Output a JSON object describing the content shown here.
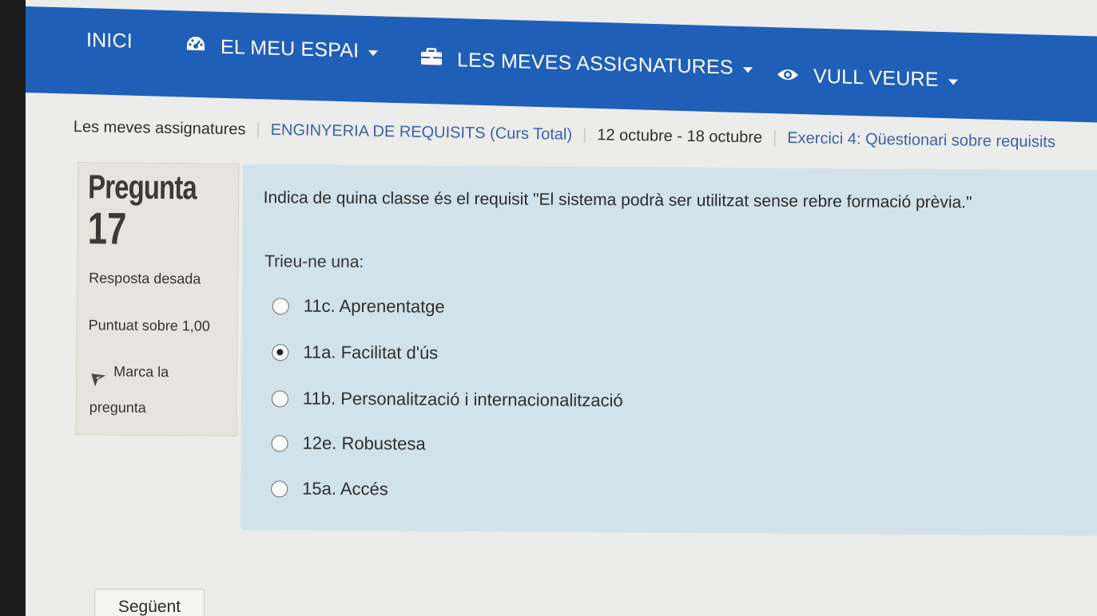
{
  "navbar": {
    "items": [
      {
        "label": "INICI",
        "icon": ""
      },
      {
        "label": "EL MEU ESPAI",
        "icon": "dashboard-icon"
      },
      {
        "label": "LES MEVES ASSIGNATURES",
        "icon": "briefcase-icon"
      },
      {
        "label": "VULL VEURE",
        "icon": "eye-icon"
      }
    ],
    "color": "#1f5fb8"
  },
  "breadcrumb": [
    "Les meves assignatures",
    "ENGINYERIA DE REQUISITS (Curs Total)",
    "12 octubre - 18 octubre",
    "Exercici 4: Qüestionari sobre requisits"
  ],
  "question_info": {
    "label": "Pregunta",
    "number": "17",
    "status": "Resposta desada",
    "grade": "Puntuat sobre 1,00",
    "flag_line1": "Marca la",
    "flag_line2": "pregunta"
  },
  "question": {
    "text": "Indica de quina classe és el requisit \"El sistema podrà ser utilitzat sense rebre formació prèvia.\"",
    "prompt": "Trieu-ne una:",
    "options": [
      {
        "label": "11c. Aprenentatge",
        "selected": false
      },
      {
        "label": "11a. Facilitat d'ús",
        "selected": true
      },
      {
        "label": "11b. Personalització i internacionalització",
        "selected": false
      },
      {
        "label": "12e. Robustesa",
        "selected": false
      },
      {
        "label": "15a. Accés",
        "selected": false
      }
    ]
  },
  "next_button": "Següent"
}
